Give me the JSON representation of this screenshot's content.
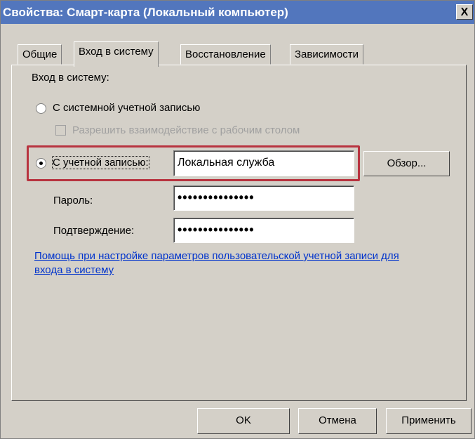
{
  "window": {
    "title": "Свойства: Смарт-карта (Локальный компьютер)",
    "close": "X"
  },
  "tabs": [
    "Общие",
    "Вход в систему",
    "Восстановление",
    "Зависимости"
  ],
  "logon": {
    "section_label": "Вход в систему:",
    "system_account": {
      "label": "С системной учетной записью",
      "selected": false
    },
    "desktop_interact": {
      "label": "Разрешить взаимодействие с рабочим столом",
      "checked": false,
      "enabled": false
    },
    "this_account": {
      "label": "С учетной записью:",
      "selected": true,
      "value": "Локальная служба"
    },
    "browse_button": "Обзор...",
    "password": {
      "label": "Пароль:",
      "value": "•••••••••••••••"
    },
    "confirm": {
      "label": "Подтверждение:",
      "value": "•••••••••••••••"
    },
    "help_link": "Помощь при настройке параметров пользовательской учетной записи для входа в систему"
  },
  "buttons": {
    "ok": "OK",
    "cancel": "Отмена",
    "apply": "Применить"
  },
  "colors": {
    "titlebar": "#5276bd",
    "highlight": "#b8333f",
    "link": "#0033cc"
  }
}
